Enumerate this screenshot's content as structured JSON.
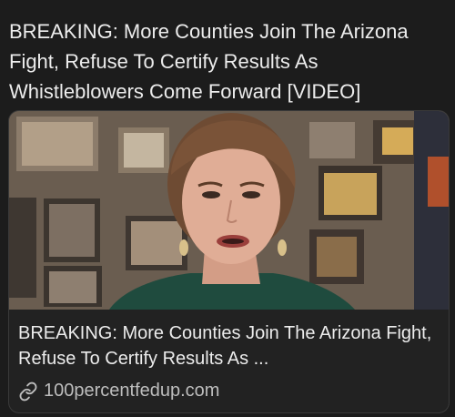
{
  "post": {
    "text": "BREAKING: More Counties Join The Arizona Fight, Refuse To Certify Results As Whistleblowers Come Forward [VIDEO]"
  },
  "link_card": {
    "title": "BREAKING: More Counties Join The Arizona Fight, Refuse To Certify Results As ...",
    "domain": "100percentfedup.com",
    "link_icon": "link-icon"
  }
}
